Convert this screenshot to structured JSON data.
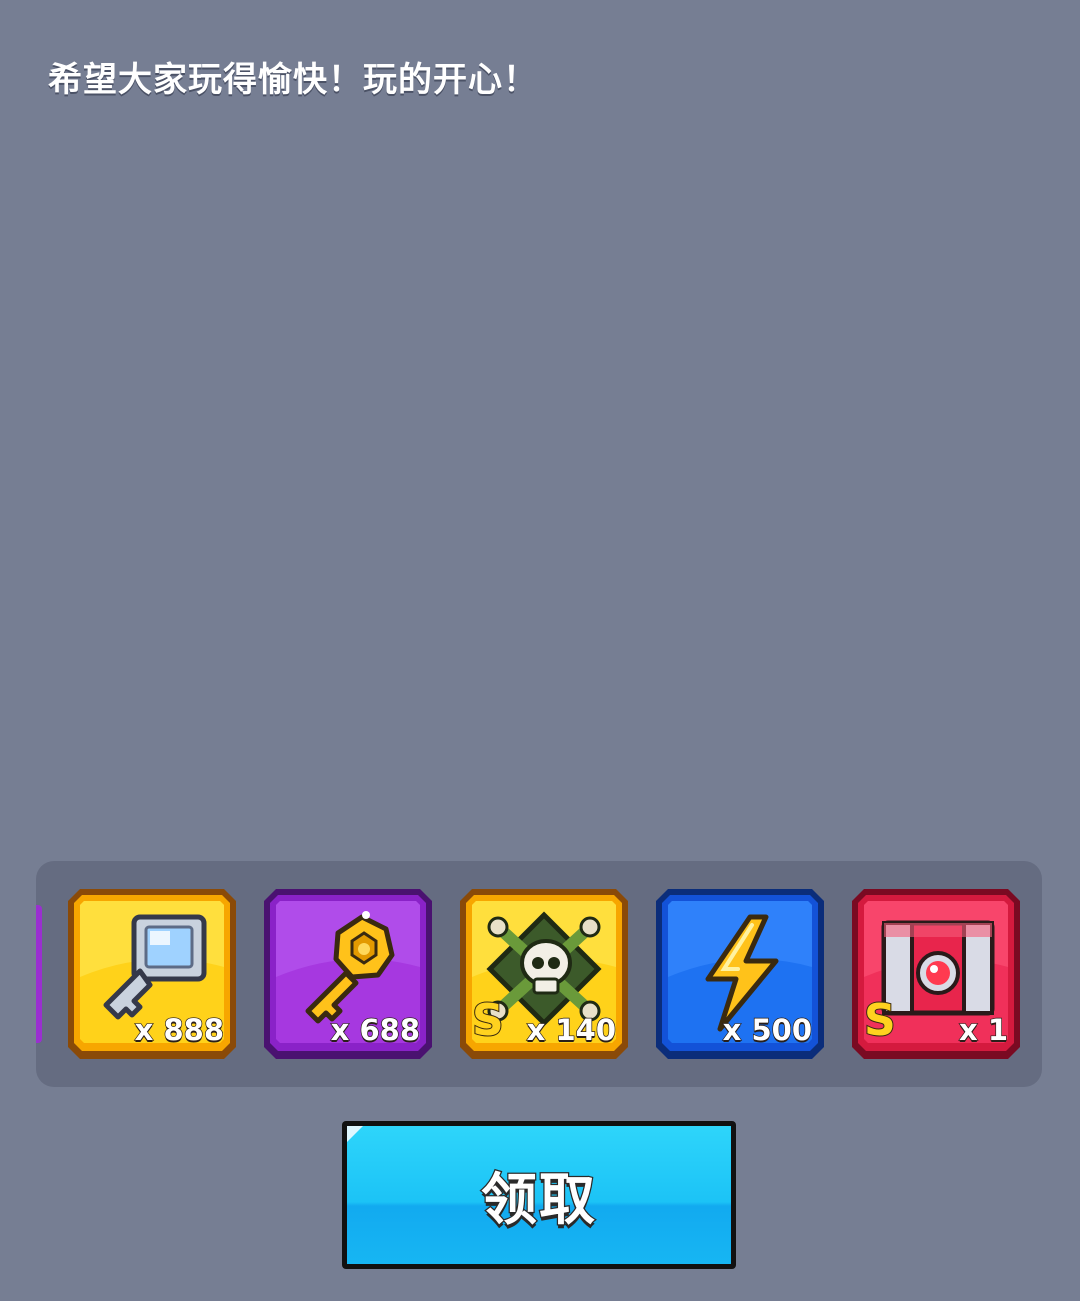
{
  "message": "希望大家玩得愉快！玩的开心！",
  "rewards": [
    {
      "icon": "silver-key-icon",
      "quantity": "x 888",
      "tier": "",
      "color": "#f5b800"
    },
    {
      "icon": "gold-key-icon",
      "quantity": "x 688",
      "tier": "",
      "color": "#a030dc"
    },
    {
      "icon": "skull-emblem-icon",
      "quantity": "x 140",
      "tier": "S",
      "color": "#f5b800"
    },
    {
      "icon": "lightning-bolt-icon",
      "quantity": "x 500",
      "tier": "",
      "color": "#1a6df2"
    },
    {
      "icon": "red-chest-icon",
      "quantity": "x 1",
      "tier": "S",
      "color": "#e8254c"
    }
  ],
  "claim_button": {
    "label": "领取"
  }
}
